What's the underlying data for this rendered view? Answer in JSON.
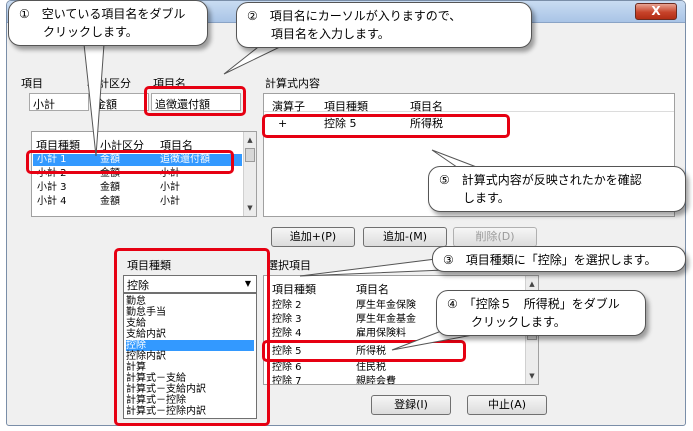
{
  "window": {
    "close_label": "X"
  },
  "form": {
    "item_label": "項目",
    "subtotal_label": "小計区分",
    "name_label": "項目名",
    "item_value": "小計",
    "subtotal_value": "金額",
    "name_value": "追徴還付額"
  },
  "left_list": {
    "headers": [
      "項目種類",
      "小計区分",
      "項目名"
    ],
    "rows": [
      [
        "小計 1",
        "金額",
        "追徴還付額"
      ],
      [
        "小計 2",
        "金額",
        "小計"
      ],
      [
        "小計 3",
        "金額",
        "小計"
      ],
      [
        "小計 4",
        "金額",
        "小計"
      ]
    ]
  },
  "formula": {
    "title": "計算式内容",
    "headers": [
      "演算子",
      "項目種類",
      "項目名"
    ],
    "row": [
      "+",
      "控除 5",
      "所得税"
    ]
  },
  "buttons": {
    "add_plus": "追加+(P)",
    "add_minus": "追加-(M)",
    "delete": "削除(D)",
    "register": "登録(I)",
    "cancel": "中止(A)"
  },
  "item_type": {
    "label": "項目種類",
    "selected": "控除",
    "options": [
      "勤怠",
      "勤怠手当",
      "支給",
      "支給内訳",
      "控除",
      "控除内訳",
      "計算",
      "計算式－支給",
      "計算式－支給内訳",
      "計算式－控除",
      "計算式－控除内訳"
    ],
    "selected_index": 4
  },
  "selection": {
    "title": "選択項目",
    "headers": [
      "項目種類",
      "項目名"
    ],
    "rows": [
      [
        "控除 2",
        "厚生年金保険"
      ],
      [
        "控除 3",
        "厚生年金基金"
      ],
      [
        "控除 4",
        "雇用保険料"
      ],
      [
        "控除 5",
        "所得税"
      ],
      [
        "控除 6",
        "住民税"
      ],
      [
        "控除 7",
        "親睦会費"
      ]
    ]
  },
  "callouts": {
    "c1": [
      "①　空いている項目名をダブル",
      "　　クリックします。"
    ],
    "c2": [
      "②　項目名にカーソルが入りますので、",
      "　　項目名を入力します。"
    ],
    "c3": [
      "③　項目種類に「控除」を選択します。"
    ],
    "c4": [
      "④　「控除５　所得税」をダブル",
      "　　クリックします。"
    ],
    "c5": [
      "⑤　計算式内容が反映されたかを確認",
      "　　します。"
    ]
  },
  "colors": {
    "annotation_red": "#e60012",
    "selection_blue": "#3399ff"
  }
}
